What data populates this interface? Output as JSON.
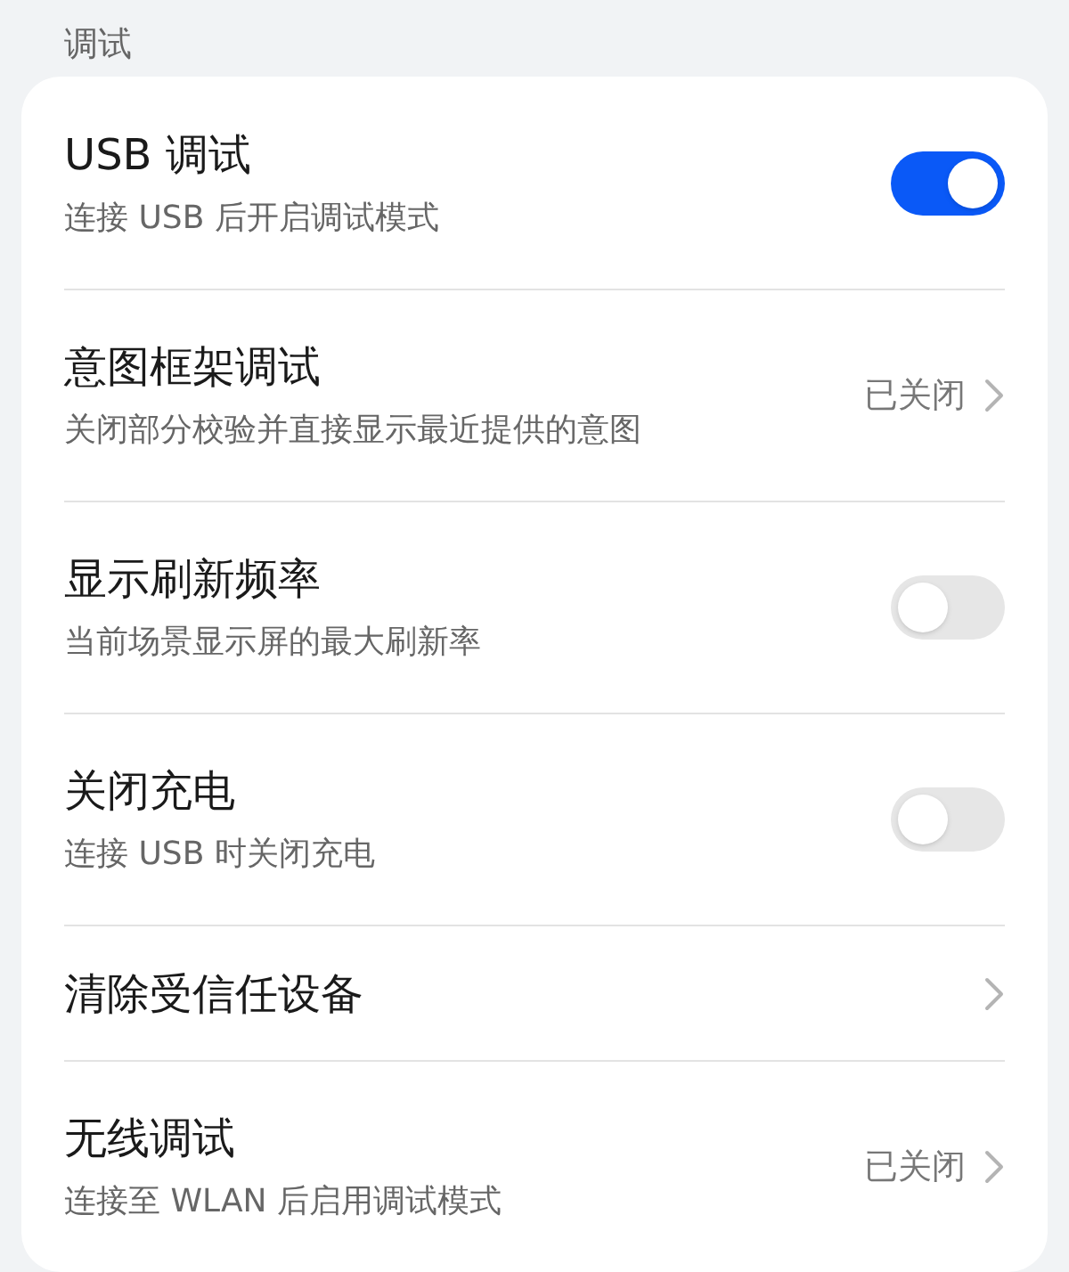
{
  "section_title": "调试",
  "rows": [
    {
      "kind": "toggle",
      "title": "USB 调试",
      "subtitle": "连接 USB 后开启调试模式",
      "on": true
    },
    {
      "kind": "link",
      "title": "意图框架调试",
      "subtitle": "关闭部分校验并直接显示最近提供的意图",
      "value": "已关闭"
    },
    {
      "kind": "toggle",
      "title": "显示刷新频率",
      "subtitle": "当前场景显示屏的最大刷新率",
      "on": false
    },
    {
      "kind": "toggle",
      "title": "关闭充电",
      "subtitle": "连接 USB 时关闭充电",
      "on": false
    },
    {
      "kind": "link",
      "title": "清除受信任设备"
    },
    {
      "kind": "link",
      "title": "无线调试",
      "subtitle": "连接至 WLAN 后启用调试模式",
      "value": "已关闭"
    }
  ]
}
